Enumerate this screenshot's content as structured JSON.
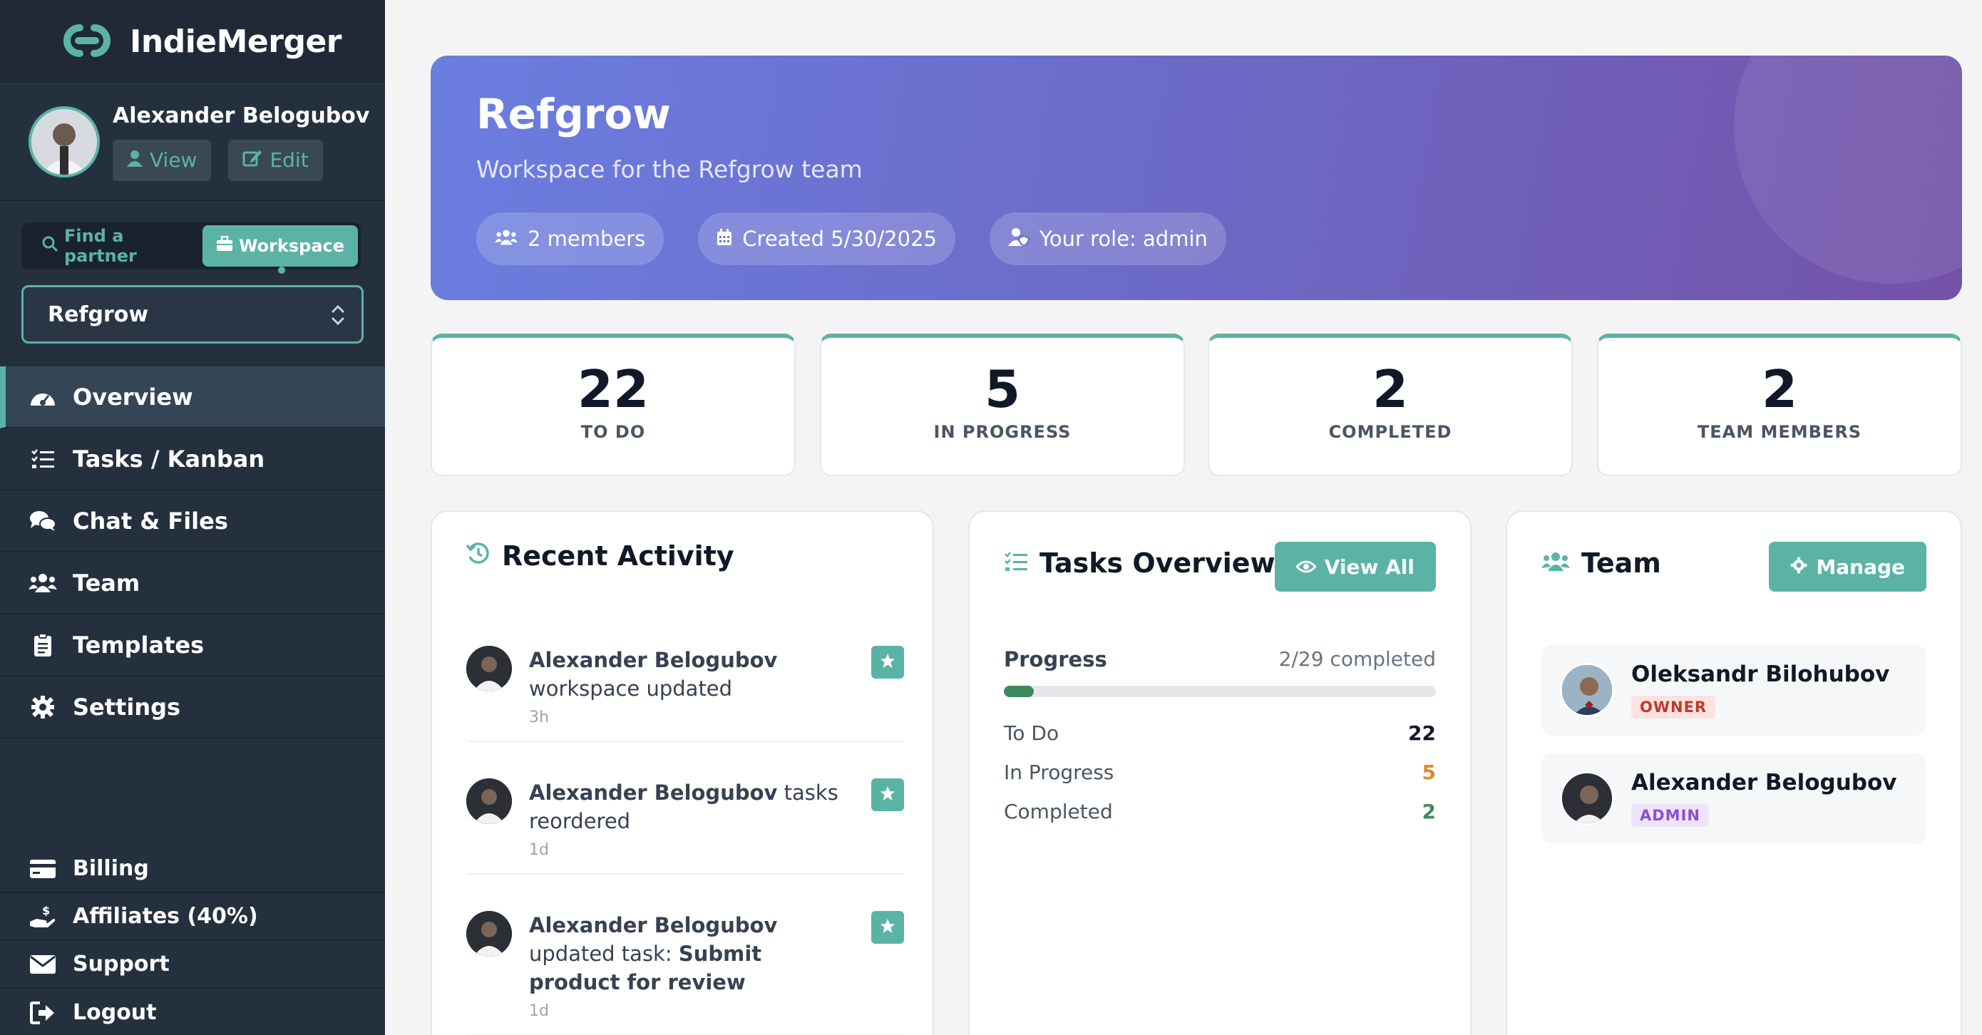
{
  "app": {
    "name": "IndieMerger",
    "brand_color": "#5bb3a6"
  },
  "profile": {
    "name": "Alexander Belogubov",
    "view_label": "View",
    "edit_label": "Edit"
  },
  "mode_toggle": {
    "find_label": "Find a partner",
    "workspace_label": "Workspace",
    "active": "Workspace"
  },
  "workspace_select": {
    "value": "Refgrow"
  },
  "nav": {
    "items": [
      {
        "label": "Overview",
        "icon": "dashboard-icon",
        "active": true
      },
      {
        "label": "Tasks / Kanban",
        "icon": "tasks-icon"
      },
      {
        "label": "Chat & Files",
        "icon": "chat-icon"
      },
      {
        "label": "Team",
        "icon": "users-icon"
      },
      {
        "label": "Templates",
        "icon": "clipboard-icon"
      },
      {
        "label": "Settings",
        "icon": "gear-icon"
      }
    ],
    "bottom": [
      {
        "label": "Billing",
        "icon": "credit-card-icon"
      },
      {
        "label": "Affiliates (40%)",
        "icon": "hand-dollar-icon"
      },
      {
        "label": "Support",
        "icon": "envelope-icon"
      },
      {
        "label": "Logout",
        "icon": "logout-icon"
      }
    ]
  },
  "hero": {
    "title": "Refgrow",
    "subtitle": "Workspace for the Refgrow team",
    "members": "2 members",
    "created": "Created 5/30/2025",
    "role": "Your role: admin"
  },
  "stats": [
    {
      "value": "22",
      "label": "TO DO"
    },
    {
      "value": "5",
      "label": "IN PROGRESS"
    },
    {
      "value": "2",
      "label": "COMPLETED"
    },
    {
      "value": "2",
      "label": "TEAM MEMBERS"
    }
  ],
  "activity": {
    "title": "Recent Activity",
    "items": [
      {
        "user": "Alexander Belogubov",
        "text": "workspace updated",
        "bold_tail": "",
        "time": "3h"
      },
      {
        "user": "Alexander Belogubov",
        "text": "tasks reordered",
        "bold_tail": "",
        "time": "1d"
      },
      {
        "user": "Alexander Belogubov",
        "text": "updated task:",
        "bold_tail": "Submit product for review",
        "time": "1d"
      }
    ]
  },
  "tasks_overview": {
    "title": "Tasks Overview",
    "view_all_label": "View All",
    "progress_label": "Progress",
    "progress_text": "2/29 completed",
    "progress_fraction": 0.069,
    "rows": [
      {
        "label": "To Do",
        "value": "22",
        "color": "#111827"
      },
      {
        "label": "In Progress",
        "value": "5",
        "color": "#e08a2c"
      },
      {
        "label": "Completed",
        "value": "2",
        "color": "#3d8b5c"
      }
    ]
  },
  "team": {
    "title": "Team",
    "manage_label": "Manage",
    "members": [
      {
        "name": "Oleksandr Bilohubov",
        "role": "OWNER",
        "badge_bg": "#fde2e2",
        "badge_fg": "#c0392b"
      },
      {
        "name": "Alexander Belogubov",
        "role": "ADMIN",
        "badge_bg": "#ede4fb",
        "badge_fg": "#8a4fd1"
      }
    ]
  }
}
